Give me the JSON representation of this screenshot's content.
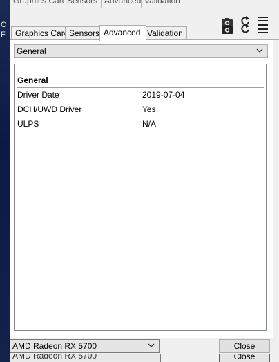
{
  "tabs": [
    {
      "label": "Graphics Card"
    },
    {
      "label": "Sensors"
    },
    {
      "label": "Advanced"
    },
    {
      "label": "Validation"
    }
  ],
  "active_tab": "Advanced",
  "section_select": {
    "value": "General"
  },
  "details": {
    "group_title": "General",
    "rows": [
      {
        "key": "Driver Date",
        "value": "2019-07-04"
      },
      {
        "key": "DCH/UWD Driver",
        "value": "Yes"
      },
      {
        "key": "ULPS",
        "value": "N/A"
      }
    ]
  },
  "footer": {
    "gpu_select": "AMD Radeon RX 5700",
    "close_label": "Close"
  },
  "toolbar_icons": [
    "camera-icon",
    "refresh-icon",
    "menu-icon"
  ],
  "colors": {
    "focus_border": "#0078d7",
    "panel_bg": "#ffffff",
    "window_bg": "#f0f0f0"
  }
}
